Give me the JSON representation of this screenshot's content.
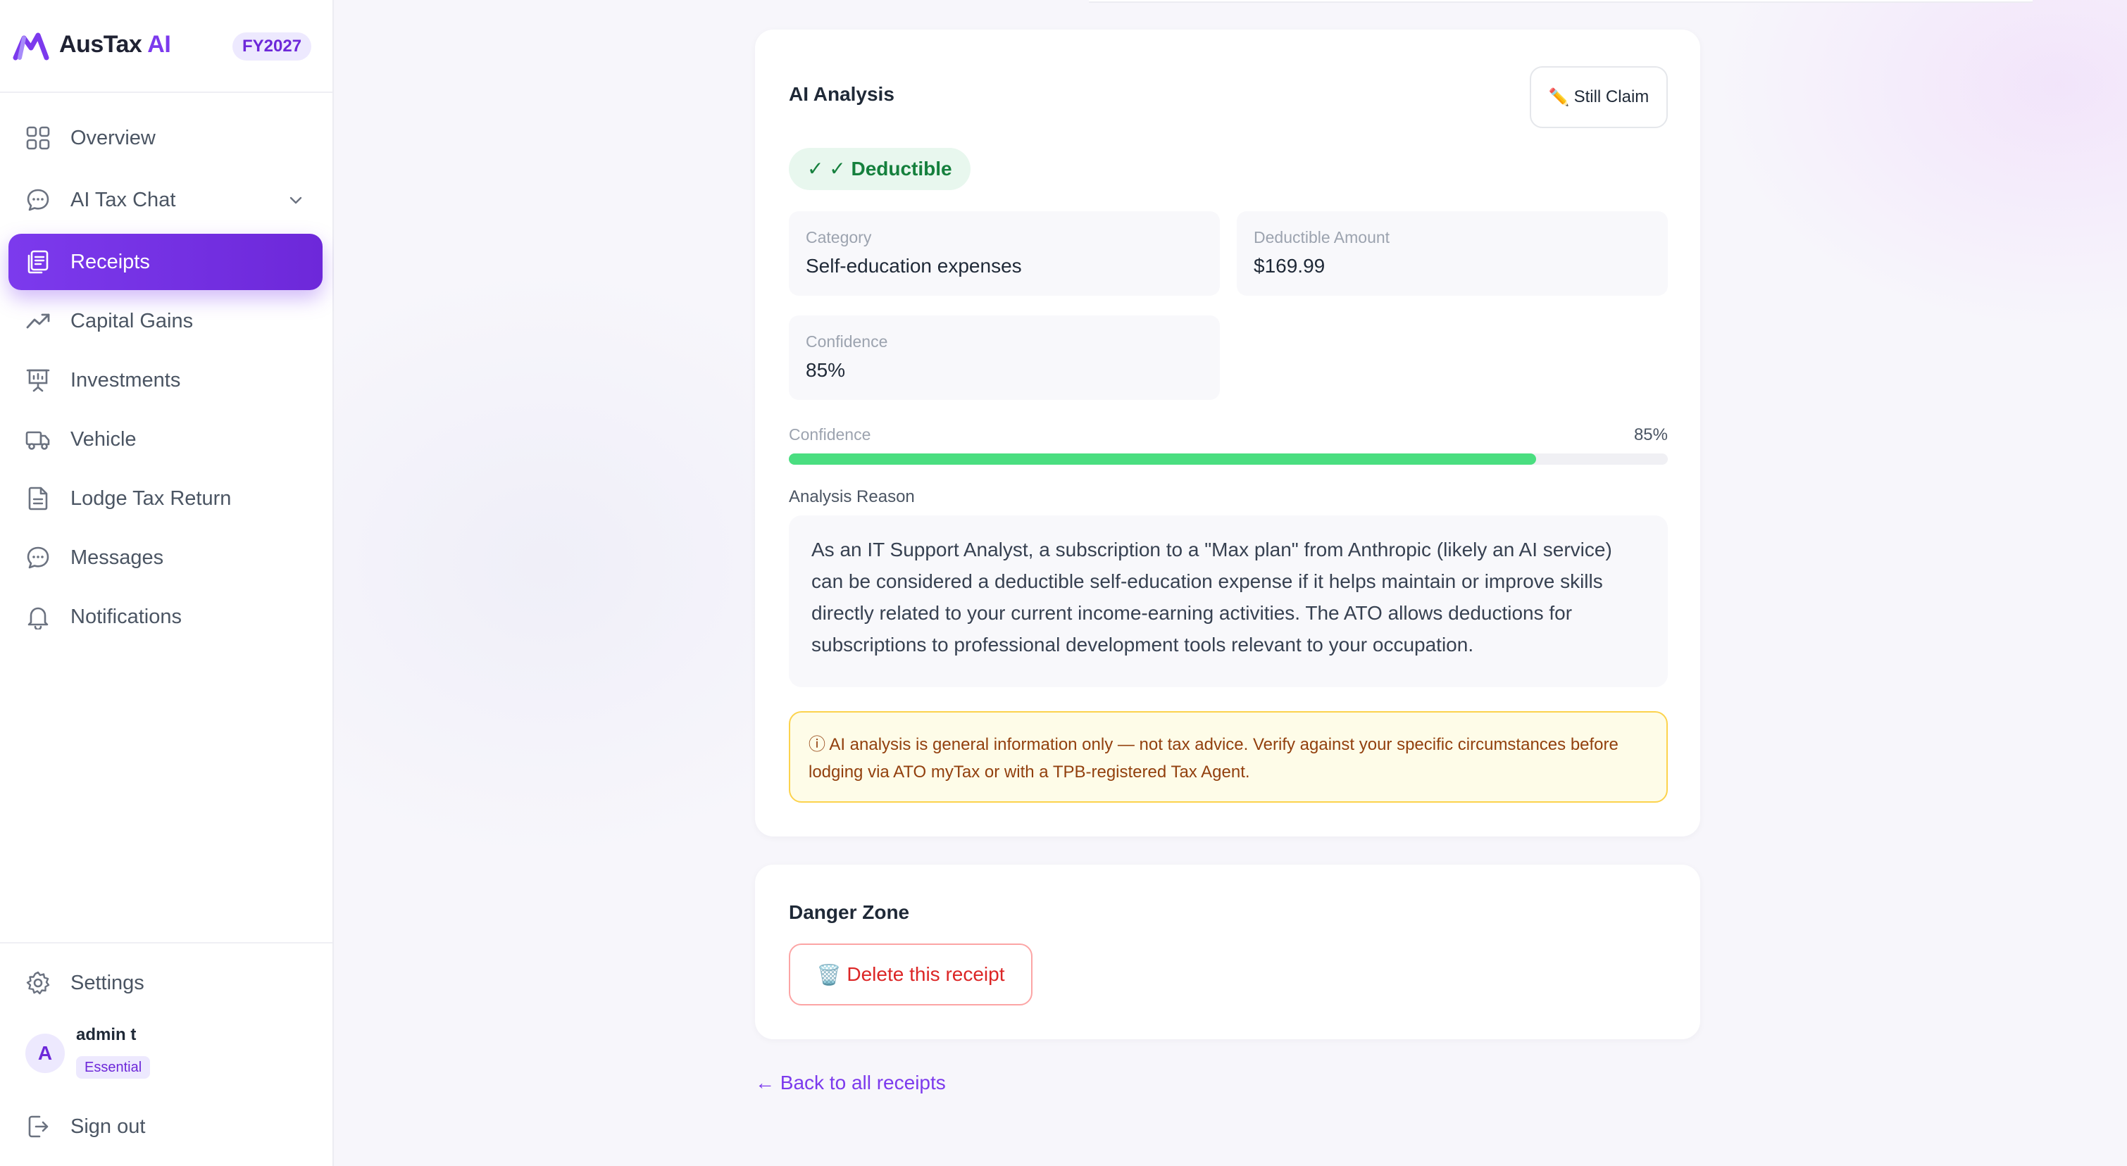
{
  "brand": {
    "name": "AusTax",
    "name_ai": "AI",
    "fy_badge": "FY2027",
    "accent_color": "#7c3aed"
  },
  "sidebar": {
    "items": [
      {
        "label": "Overview",
        "icon": "grid-icon"
      },
      {
        "label": "AI Tax Chat",
        "icon": "chat-icon",
        "has_chevron": true
      },
      {
        "label": "Receipts",
        "icon": "receipt-icon",
        "active": true
      },
      {
        "label": "Capital Gains",
        "icon": "trending-up-icon"
      },
      {
        "label": "Investments",
        "icon": "presentation-chart-icon"
      },
      {
        "label": "Vehicle",
        "icon": "truck-icon"
      },
      {
        "label": "Lodge Tax Return",
        "icon": "document-icon"
      },
      {
        "label": "Messages",
        "icon": "message-icon"
      },
      {
        "label": "Notifications",
        "icon": "bell-icon"
      }
    ],
    "settings_label": "Settings",
    "signout_label": "Sign out",
    "user": {
      "initial": "A",
      "name": "admin t",
      "plan": "Essential"
    }
  },
  "ai_analysis": {
    "title": "AI Analysis",
    "still_claim_label": "Still Claim",
    "status_badge": "✓ ✓ Deductible",
    "fields": {
      "category_label": "Category",
      "category_value": "Self-education expenses",
      "amount_label": "Deductible Amount",
      "amount_value": "$169.99",
      "confidence_label": "Confidence",
      "confidence_value": "85%"
    },
    "confidence_bar": {
      "label": "Confidence",
      "value_text": "85%",
      "value": 0.85,
      "color": "#4ade80"
    },
    "reason_label": "Analysis Reason",
    "reason_text": "As an IT Support Analyst, a subscription to a \"Max plan\" from Anthropic (likely an AI service) can be considered a deductible self-education expense if it helps maintain or improve skills directly related to your current income-earning activities. The ATO allows deductions for subscriptions to professional development tools relevant to your occupation.",
    "disclaimer": "ⓘ AI analysis is general information only — not tax advice. Verify against your specific circumstances before lodging via ATO myTax or with a TPB-registered Tax Agent."
  },
  "danger_zone": {
    "title": "Danger Zone",
    "delete_label": "Delete this receipt",
    "danger_color": "#dc2626"
  },
  "back_link": "← Back to all receipts"
}
